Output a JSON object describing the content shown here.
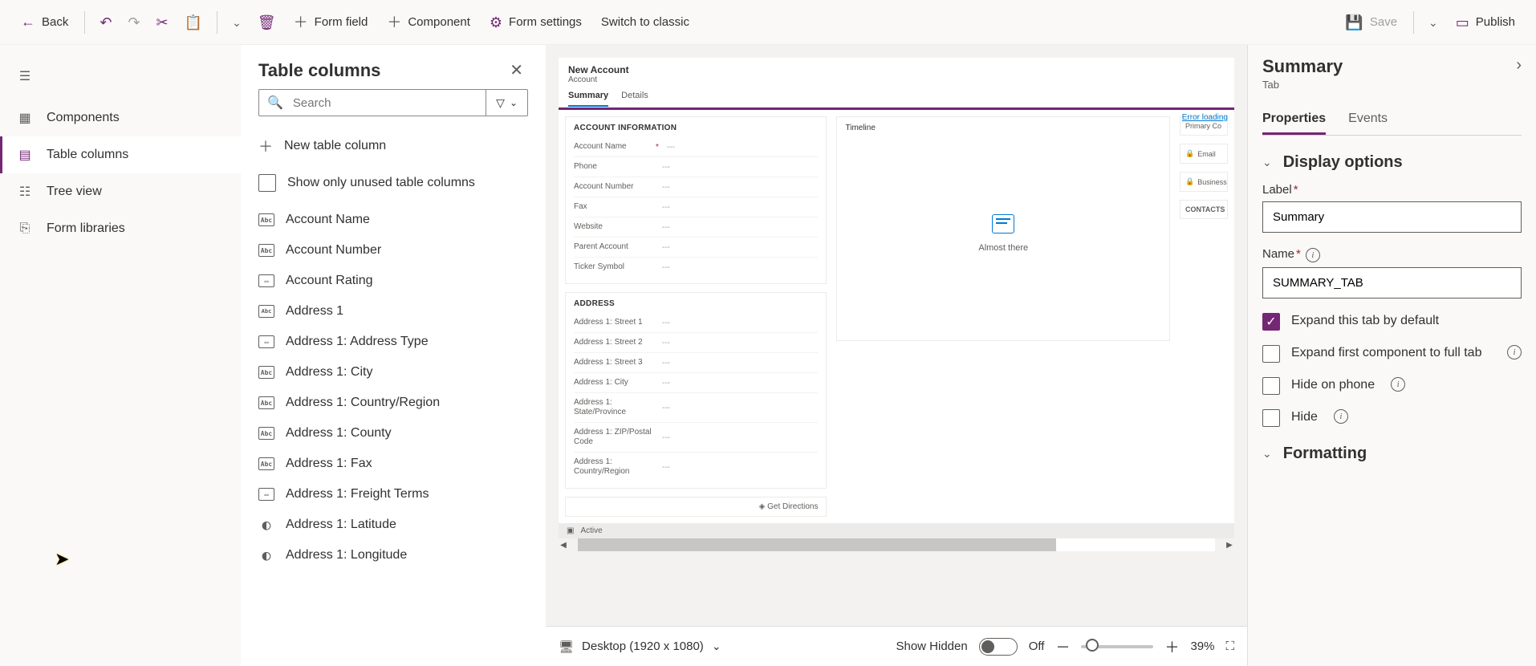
{
  "toolbar": {
    "back": "Back",
    "form_field": "Form field",
    "component": "Component",
    "form_settings": "Form settings",
    "switch_classic": "Switch to classic",
    "save": "Save",
    "publish": "Publish"
  },
  "left_nav": {
    "components": "Components",
    "table_columns": "Table columns",
    "tree_view": "Tree view",
    "form_libraries": "Form libraries"
  },
  "tc_panel": {
    "title": "Table columns",
    "search_placeholder": "Search",
    "new_column": "New table column",
    "show_unused": "Show only unused table columns",
    "columns": [
      {
        "type": "Abc",
        "label": "Account Name"
      },
      {
        "type": "Abc",
        "label": "Account Number"
      },
      {
        "type": "opt",
        "label": "Account Rating"
      },
      {
        "type": "Abcdef",
        "label": "Address 1"
      },
      {
        "type": "opt",
        "label": "Address 1: Address Type"
      },
      {
        "type": "Abc",
        "label": "Address 1: City"
      },
      {
        "type": "Abc",
        "label": "Address 1: Country/Region"
      },
      {
        "type": "Abc",
        "label": "Address 1: County"
      },
      {
        "type": "Abc",
        "label": "Address 1: Fax"
      },
      {
        "type": "opt",
        "label": "Address 1: Freight Terms"
      },
      {
        "type": "globe",
        "label": "Address 1: Latitude"
      },
      {
        "type": "globe",
        "label": "Address 1: Longitude"
      }
    ]
  },
  "canvas": {
    "header_title": "New Account",
    "header_sub": "Account",
    "tabs": [
      "Summary",
      "Details"
    ],
    "error": "Error loading",
    "sec_account": "ACCOUNT INFORMATION",
    "sec_address": "ADDRESS",
    "sec_timeline": "Timeline",
    "tl_msg": "Almost there",
    "account_fields": [
      {
        "label": "Account Name",
        "req": true
      },
      {
        "label": "Phone"
      },
      {
        "label": "Account Number"
      },
      {
        "label": "Fax"
      },
      {
        "label": "Website"
      },
      {
        "label": "Parent Account"
      },
      {
        "label": "Ticker Symbol"
      }
    ],
    "address_fields": [
      {
        "label": "Address 1: Street 1"
      },
      {
        "label": "Address 1: Street 2"
      },
      {
        "label": "Address 1: Street 3"
      },
      {
        "label": "Address 1: City"
      },
      {
        "label": "Address 1: State/Province"
      },
      {
        "label": "Address 1: ZIP/Postal Code"
      },
      {
        "label": "Address 1: Country/Region"
      }
    ],
    "side": {
      "primary_contact": "Primary Co",
      "email": "Email",
      "business": "Business",
      "contacts": "CONTACTS"
    },
    "get_directions": "Get Directions",
    "footer_status": "Active"
  },
  "canvas_bottom": {
    "device": "Desktop (1920 x 1080)",
    "show_hidden": "Show Hidden",
    "toggle_state": "Off",
    "zoom": "39%"
  },
  "props": {
    "title": "Summary",
    "sub": "Tab",
    "tabs": [
      "Properties",
      "Events"
    ],
    "sec_display": "Display options",
    "label_field": "Label",
    "label_value": "Summary",
    "name_field": "Name",
    "name_value": "SUMMARY_TAB",
    "expand_default": "Expand this tab by default",
    "expand_first": "Expand first component to full tab",
    "hide_phone": "Hide on phone",
    "hide": "Hide",
    "sec_formatting": "Formatting"
  }
}
